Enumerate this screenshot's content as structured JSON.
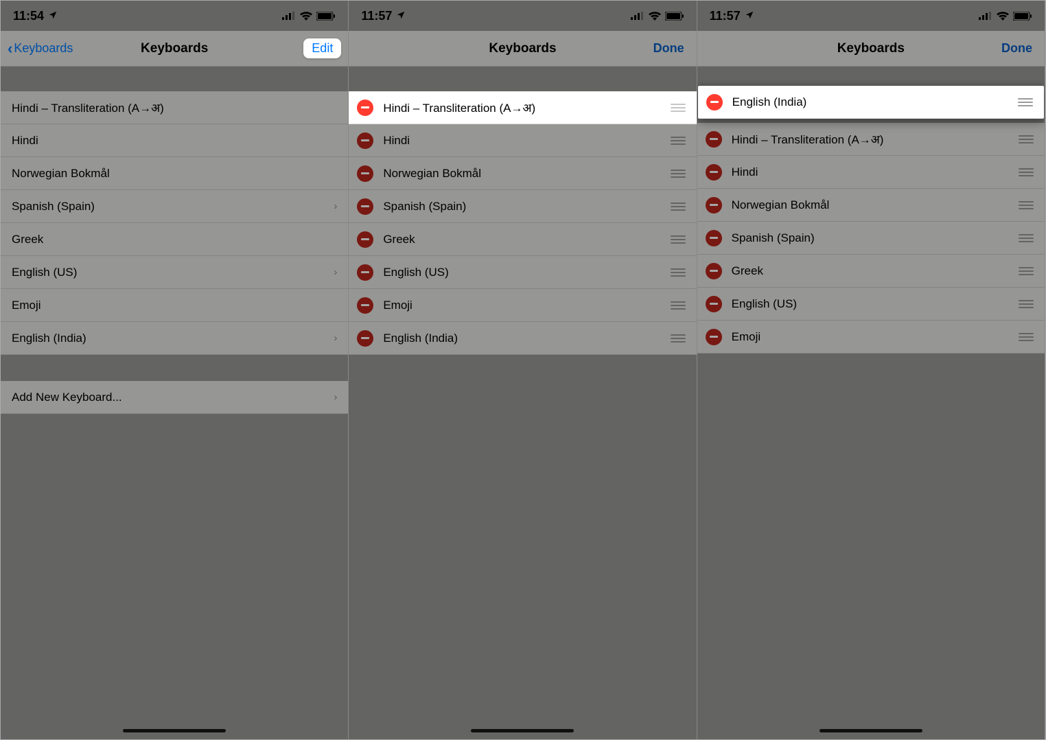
{
  "panel1": {
    "time": "11:54",
    "back_label": "Keyboards",
    "title": "Keyboards",
    "edit_label": "Edit",
    "items": [
      {
        "label": "Hindi – Transliteration (A→अ)",
        "disclosure": false
      },
      {
        "label": "Hindi",
        "disclosure": false
      },
      {
        "label": "Norwegian Bokmål",
        "disclosure": false
      },
      {
        "label": "Spanish (Spain)",
        "disclosure": true
      },
      {
        "label": "Greek",
        "disclosure": false
      },
      {
        "label": "English (US)",
        "disclosure": true
      },
      {
        "label": "Emoji",
        "disclosure": false
      },
      {
        "label": "English (India)",
        "disclosure": true
      }
    ],
    "add_label": "Add New Keyboard..."
  },
  "panel2": {
    "time": "11:57",
    "title": "Keyboards",
    "done_label": "Done",
    "items": [
      "Hindi – Transliteration (A→अ)",
      "Hindi",
      "Norwegian Bokmål",
      "Spanish (Spain)",
      "Greek",
      "English (US)",
      "Emoji",
      "English (India)"
    ],
    "highlight_index": 0
  },
  "panel3": {
    "time": "11:57",
    "title": "Keyboards",
    "done_label": "Done",
    "floating_label": "English (India)",
    "items": [
      "Hindi – Transliteration (A→अ)",
      "Hindi",
      "Norwegian Bokmål",
      "Spanish (Spain)",
      "Greek",
      "English (US)",
      "Emoji"
    ]
  }
}
